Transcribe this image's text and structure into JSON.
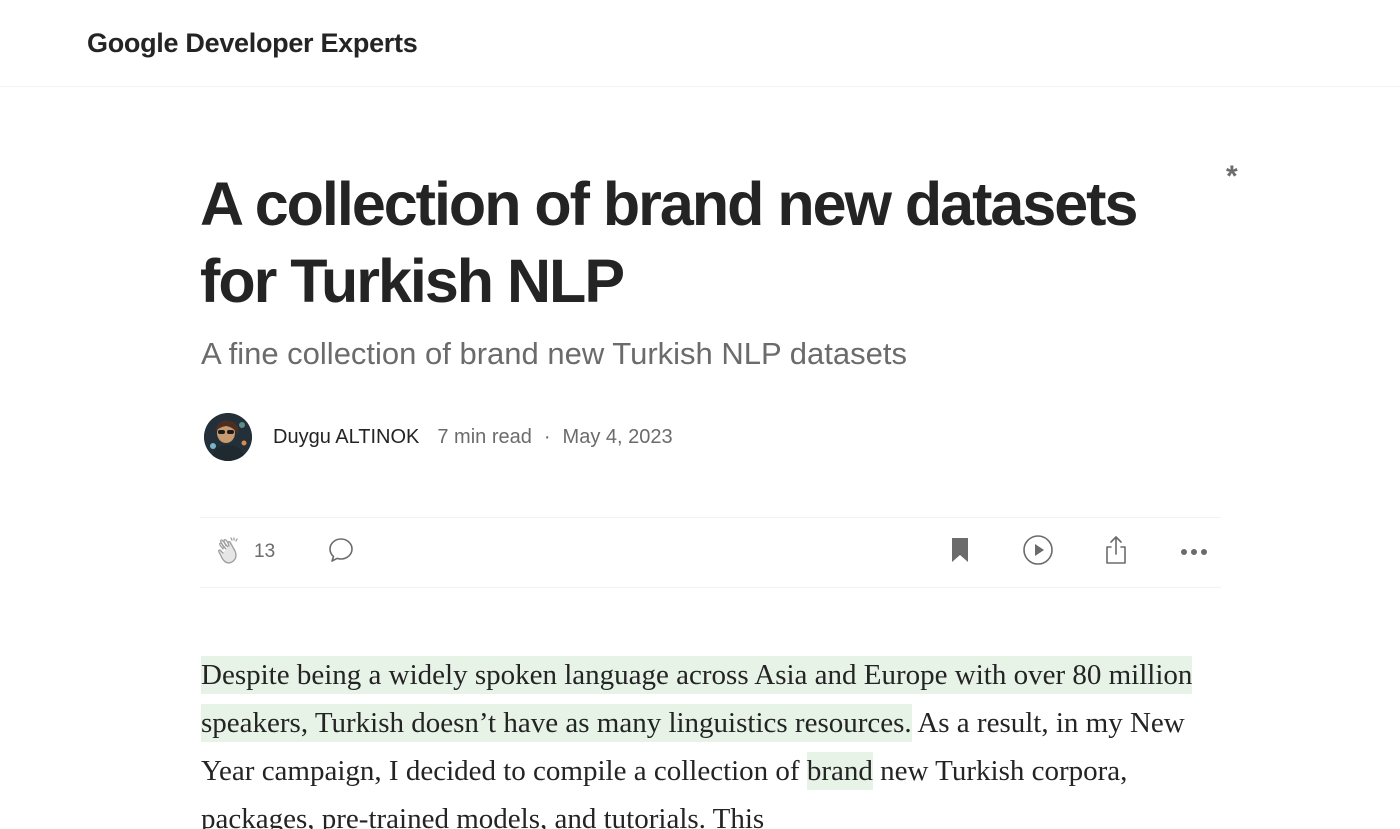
{
  "header": {
    "publication_name": "Google Developer Experts"
  },
  "article": {
    "marker": "*",
    "title": "A collection of brand new datasets for Turkish NLP",
    "subtitle": "A fine collection of brand new Turkish NLP datasets",
    "author": "Duygu ALTINOK",
    "read_time": "7 min read",
    "separator": "·",
    "date": "May 4, 2023",
    "body": {
      "highlight_1": "Despite being a widely spoken language across Asia and Europe with over 80 million speakers, Turkish doesn’t have as many linguistics resources.",
      "text_1": " As a result, in my New Year campaign, I decided to compile a collection of ",
      "highlight_2": "brand",
      "text_2": " new Turkish corpora, packages, pre-trained models, and tutorials. This"
    }
  },
  "actions": {
    "clap_count": "13",
    "icons": [
      "clap-icon",
      "comment-icon",
      "bookmark-icon",
      "play-icon",
      "share-icon",
      "more-icon"
    ]
  },
  "colors": {
    "text": "#242424",
    "muted": "#6b6b6b",
    "highlight": "#e8f3e8",
    "divider": "#f2f2f2"
  }
}
